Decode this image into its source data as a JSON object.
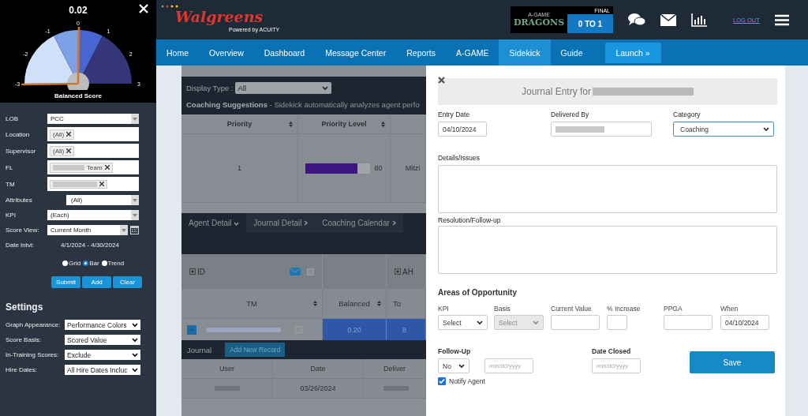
{
  "gauge": {
    "value": "0.02",
    "ticks": [
      "-3",
      "-2",
      "-1",
      "0",
      "1",
      "2",
      "3"
    ],
    "title": "Balanced Score"
  },
  "filters": [
    {
      "kind": "select",
      "label": "LOB",
      "value": "PCC"
    },
    {
      "kind": "chips",
      "label": "Location",
      "chips": [
        {
          "text": "(All)",
          "redacted": false
        }
      ]
    },
    {
      "kind": "chips",
      "label": "Supervisor",
      "chips": [
        {
          "text": "(All)",
          "redacted": false
        }
      ]
    },
    {
      "kind": "chips",
      "label": "FL",
      "chips": [
        {
          "text": "Team",
          "redacted": true
        }
      ]
    },
    {
      "kind": "chips",
      "label": "TM",
      "chips": [
        {
          "redacted": true
        }
      ]
    },
    {
      "kind": "select",
      "label": "Attributes",
      "value": "(All)",
      "indent": true
    },
    {
      "kind": "select",
      "label": "KPI",
      "value": "(Each)"
    },
    {
      "kind": "calendar",
      "label": "Score View:",
      "value": "Current Month"
    },
    {
      "kind": "text",
      "label": "Date Intvl:",
      "value": "4/1/2024 - 4/30/2024"
    }
  ],
  "views": [
    {
      "label": "Grid",
      "selected": false
    },
    {
      "label": "Bar",
      "selected": true
    },
    {
      "label": "Trend",
      "selected": false
    }
  ],
  "actions": [
    "Submit",
    "Add",
    "Clear"
  ],
  "settings": {
    "title": "Settings",
    "rows": [
      {
        "label": "Graph Appearance:",
        "value": "Performance Colors"
      },
      {
        "label": "Score Basis:",
        "value": "Scored Value"
      },
      {
        "label": "In-Training Scores:",
        "value": "Exclude"
      },
      {
        "label": "Hire Dates:",
        "value": "All Hire Dates Incluc"
      }
    ]
  },
  "header": {
    "logo": "Walgreens",
    "powered_by": "Powered by ACUITY",
    "game": {
      "title": "A-GAME",
      "team": "DRAGONS",
      "status": "FINAL",
      "score": "0 TO 1"
    },
    "logout": "LOG OUT"
  },
  "nav": [
    {
      "label": "Home",
      "selected": false
    },
    {
      "label": "Overview",
      "selected": false
    },
    {
      "label": "Dashboard",
      "selected": false
    },
    {
      "label": "Message Center",
      "selected": false
    },
    {
      "label": "Reports",
      "selected": false
    },
    {
      "label": "A-GAME",
      "selected": false
    },
    {
      "label": "Sidekick",
      "selected": true
    },
    {
      "label": "Guide",
      "selected": false
    }
  ],
  "launch": "Launch »",
  "background": {
    "display_type": {
      "label": "Display Type :",
      "value": "All"
    },
    "suggestions": "**Coaching Suggestions** - Sidekick automatically analyzes agent perfo",
    "suggestion_columns": [
      "Priority",
      "Priority Level"
    ],
    "suggestion_row": {
      "priority": "1",
      "level": 0.8,
      "reading": "80",
      "column_3": "Mitzi"
    },
    "tabs": [
      {
        "label": "Agent Detail",
        "selected": true
      },
      {
        "label": "Journal Detail",
        "selected": false
      },
      {
        "label": "Coaching Calendar",
        "selected": false
      }
    ],
    "group_headers": [
      "ID",
      "AH"
    ],
    "columns": [
      "TM",
      "Balanced",
      "To"
    ],
    "select_all_checked": false,
    "row": {
      "balanced": "0.20",
      "column_3": "8",
      "checked": false
    },
    "journal": {
      "title": "Journal",
      "button": "Add New Record",
      "columns": [
        "User",
        "Date",
        "Deliver"
      ],
      "row": {
        "date": "03/26/2024"
      }
    }
  },
  "modal": {
    "title": "Journal Entry for",
    "entry_date": {
      "label": "Entry Date",
      "value": "04/10/2024"
    },
    "delivered_by": {
      "label": "Delivered By"
    },
    "category": {
      "label": "Category",
      "value": "Coaching"
    },
    "details": {
      "label": "Details/Issues"
    },
    "resolution": {
      "label": "Resolution/Follow-up"
    },
    "areas_title": "Areas of Opportunity",
    "areas": [
      {
        "kind": "select",
        "label": "KPI",
        "value": "Select",
        "disabled": false
      },
      {
        "kind": "select",
        "label": "Basis",
        "value": "Select",
        "disabled": true
      },
      {
        "kind": "input",
        "label": "Current Value"
      },
      {
        "kind": "small",
        "label": "% Increase"
      },
      {
        "kind": "input",
        "label": "PPGA"
      },
      {
        "kind": "input",
        "label": "When",
        "value": "04/10/2024"
      }
    ],
    "follow_up": {
      "label": "Follow-Up",
      "value": "No",
      "placeholder": "mm/dd/yyyy"
    },
    "date_closed": {
      "label": "Date Closed",
      "placeholder": "mm/dd/yyyy"
    },
    "save": "Save",
    "notify": {
      "label": "Notify Agent",
      "checked": true
    }
  }
}
